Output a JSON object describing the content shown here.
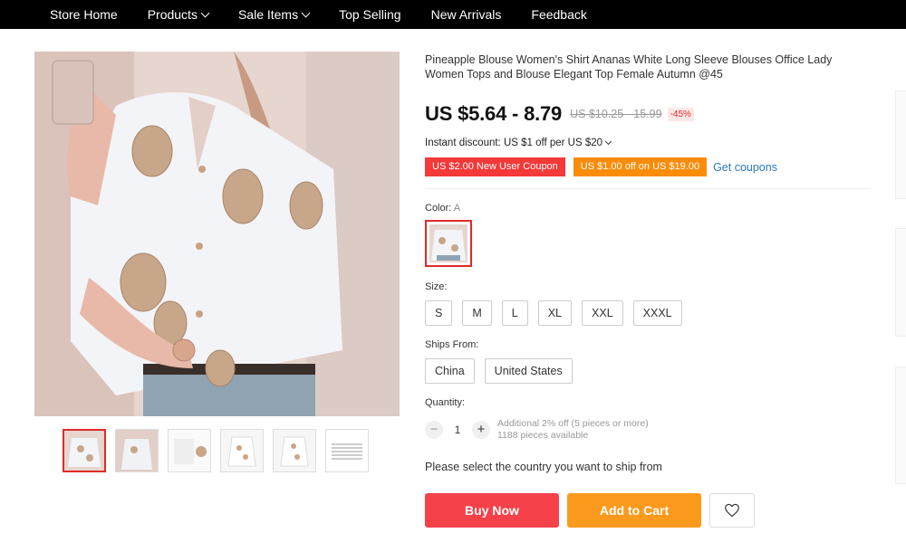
{
  "nav": {
    "items": [
      {
        "label": "Store Home",
        "dropdown": false
      },
      {
        "label": "Products",
        "dropdown": true
      },
      {
        "label": "Sale Items",
        "dropdown": true
      },
      {
        "label": "Top Selling",
        "dropdown": false
      },
      {
        "label": "New Arrivals",
        "dropdown": false
      },
      {
        "label": "Feedback",
        "dropdown": false
      }
    ]
  },
  "product": {
    "title": "Pineapple Blouse Women's Shirt Ananas White Long Sleeve Blouses Office Lady Women Tops and Blouse Elegant Top Female Autumn @45",
    "price": "US $5.64 - 8.79",
    "original_price": "US $10.25 - 15.99",
    "discount": "-45%",
    "instant_discount": "Instant discount: US $1 off per US $20",
    "coupons": [
      {
        "label": "US $2.00 New User Coupon",
        "color": "#f53838"
      },
      {
        "label": "US $1.00 off on US $19.00",
        "color": "#fa8c0a"
      }
    ],
    "get_coupons": "Get coupons"
  },
  "color": {
    "label": "Color:",
    "value": "A"
  },
  "size": {
    "label": "Size:",
    "options": [
      "S",
      "M",
      "L",
      "XL",
      "XXL",
      "XXXL"
    ]
  },
  "ships_from": {
    "label": "Ships From:",
    "options": [
      "China",
      "United States"
    ]
  },
  "quantity": {
    "label": "Quantity:",
    "value": "1",
    "minus": "−",
    "plus": "+",
    "additional": "Additional 2% off (5 pieces or more)",
    "available": "1188 pieces available"
  },
  "ship_message": "Please select the country you want to ship from",
  "actions": {
    "buy_now": "Buy Now",
    "add_to_cart": "Add to Cart"
  },
  "colors": {
    "accent_red": "#f4414a",
    "accent_orange": "#fc9a1d",
    "link_blue": "#2b7bb9"
  },
  "icons": [
    "heart-icon",
    "chevron-down-icon"
  ]
}
